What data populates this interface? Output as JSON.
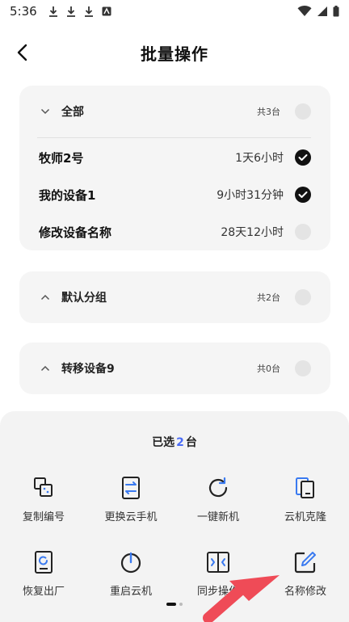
{
  "status_bar": {
    "time": "5:36"
  },
  "header": {
    "title": "批量操作"
  },
  "groups": [
    {
      "name": "全部",
      "count": "共3台",
      "devices": [
        {
          "name": "牧师2号",
          "time": "1天6小时",
          "checked": true
        },
        {
          "name": "我的设备1",
          "time": "9小时31分钟",
          "checked": true
        },
        {
          "name": "修改设备名称",
          "time": "28天12小时",
          "checked": false
        }
      ]
    },
    {
      "name": "默认分组",
      "count": "共2台"
    },
    {
      "name": "转移设备9",
      "count": "共0台"
    }
  ],
  "sheet": {
    "selected_prefix": "已选",
    "selected_count": "2",
    "selected_suffix": "台",
    "actions": [
      {
        "label": "复制编号",
        "icon": "copy-id-icon"
      },
      {
        "label": "更换云手机",
        "icon": "swap-phone-icon"
      },
      {
        "label": "一键新机",
        "icon": "refresh-icon"
      },
      {
        "label": "云机克隆",
        "icon": "clone-icon"
      },
      {
        "label": "恢复出厂",
        "icon": "factory-reset-icon"
      },
      {
        "label": "重启云机",
        "icon": "power-icon"
      },
      {
        "label": "同步操作",
        "icon": "sync-icon"
      },
      {
        "label": "名称修改",
        "icon": "edit-name-icon"
      }
    ]
  },
  "colors": {
    "accent": "#4a6cf7",
    "annotation_arrow": "#ef4b57"
  }
}
